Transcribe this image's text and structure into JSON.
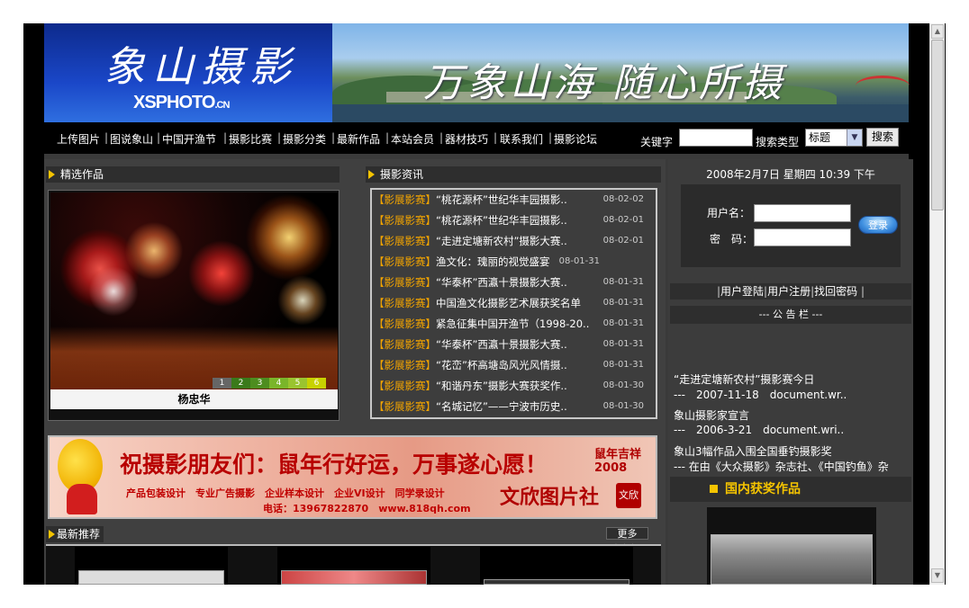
{
  "header": {
    "logo_cn": "象山摄影",
    "logo_en": "XSPHOTO",
    "logo_en_suffix": ".CN",
    "slogan": "万象山海 随心所摄"
  },
  "nav": {
    "items": [
      "上传图片",
      "图说象山",
      "中国开渔节",
      "摄影比赛",
      "摄影分类",
      "最新作品",
      "本站会员",
      "器材技巧",
      "联系我们",
      "摄影论坛"
    ],
    "separator": "|",
    "keyword_label": "关键字",
    "search_type_label": "搜索类型",
    "search_type_value": "标题",
    "search_button": "搜索"
  },
  "featured": {
    "heading": "精选作品",
    "numbers": [
      "1",
      "2",
      "3",
      "4",
      "5",
      "6"
    ],
    "active_number": "1",
    "caption": "杨忠华"
  },
  "news": {
    "heading": "摄影资讯",
    "items": [
      {
        "tag": "【影展影赛】",
        "title": "“桃花源杯”世纪华丰园摄影..",
        "date": "08-02-02"
      },
      {
        "tag": "【影展影赛】",
        "title": "“桃花源杯”世纪华丰园摄影..",
        "date": "08-02-01"
      },
      {
        "tag": "【影展影赛】",
        "title": "“走进定塘新农村”摄影大赛..",
        "date": "08-02-01"
      },
      {
        "tag": "【影展影赛】",
        "title": "渔文化：瑰丽的视觉盛宴",
        "date": "08-01-31"
      },
      {
        "tag": "【影展影赛】",
        "title": "“华泰杯”西瀛十景摄影大赛..",
        "date": "08-01-31"
      },
      {
        "tag": "【影展影赛】",
        "title": "中国渔文化摄影艺术展获奖名单",
        "date": "08-01-31"
      },
      {
        "tag": "【影展影赛】",
        "title": "紧急征集中国开渔节（1998-20..",
        "date": "08-01-31"
      },
      {
        "tag": "【影展影赛】",
        "title": "“华泰杯”西瀛十景摄影大赛..",
        "date": "08-01-31"
      },
      {
        "tag": "【影展影赛】",
        "title": "“花峦”杯高塘岛风光风情摄..",
        "date": "08-01-31"
      },
      {
        "tag": "【影展影赛】",
        "title": "“和谐丹东”摄影大赛获奖作..",
        "date": "08-01-30"
      },
      {
        "tag": "【影展影赛】",
        "title": "“名城记忆”——宁波市历史..",
        "date": "08-01-30"
      }
    ]
  },
  "ad": {
    "main": "祝摄影朋友们：鼠年行好运，万事遂心愿！",
    "year": "鼠年吉祥",
    "year_num": "2008",
    "services": "产品包装设计　专业广告摄影　企业样本设计　企业VI设计　同学录设计",
    "phone": "电话：13967822870　www.818qh.com",
    "brand": "文欣图片社",
    "seal": "文欣"
  },
  "latest": {
    "heading": "最新推荐",
    "more": "更多>>>"
  },
  "sidebar": {
    "datetime": "2008年2月7日 星期四 10:39 下午",
    "username_label": "用户名：",
    "password_label": "密　码：",
    "login_button": "登录",
    "user_links": [
      "用户登陆",
      "用户注册",
      "找回密码"
    ],
    "notice_heading": "--- 公 告 栏 ---",
    "notices": [
      {
        "title": "“走进定塘新农村”摄影赛今日",
        "meta": "---　2007-11-18　document.wr.."
      },
      {
        "title": "象山摄影家宣言",
        "meta": "---　2006-3-21　document.wri.."
      },
      {
        "title": "象山3幅作品入围全国垂钓摄影奖",
        "meta": "--- 在由《大众摄影》杂志社、《中国钓鱼》杂"
      }
    ],
    "award_heading": "国内获奖作品"
  },
  "colors": {
    "accent_orange": "#f2a400",
    "yellow": "#f5c400",
    "panel_gray": "#3a3a3a",
    "logo_blue": "#1a47c8"
  }
}
